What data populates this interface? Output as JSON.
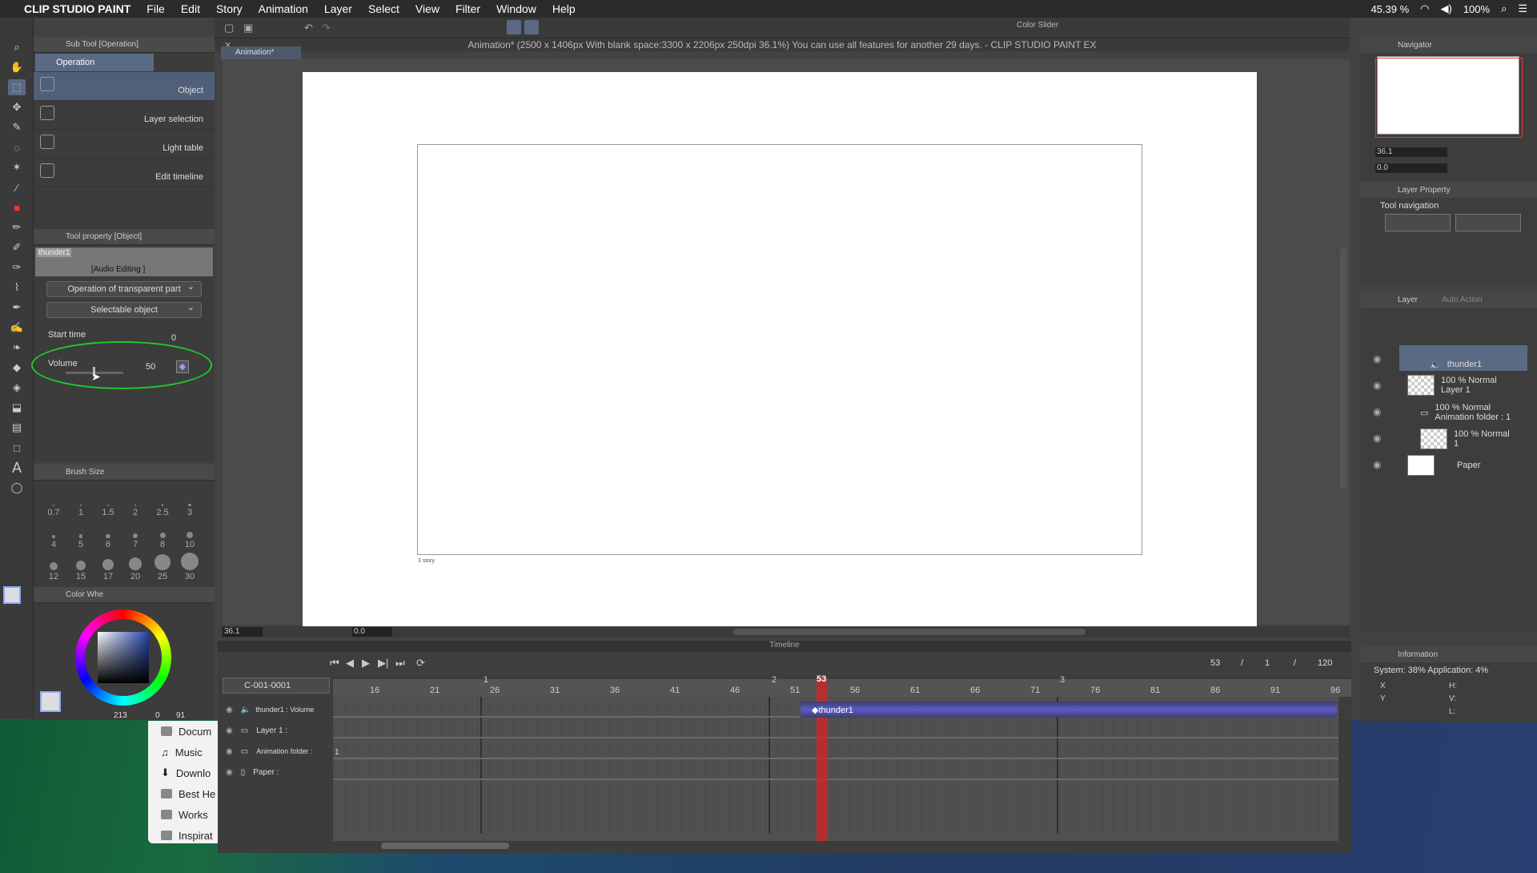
{
  "menubar": {
    "apple_icon": "apple-icon",
    "app": "CLIP STUDIO PAINT",
    "items": [
      "File",
      "Edit",
      "Story",
      "Animation",
      "Layer",
      "Select",
      "View",
      "Filter",
      "Window",
      "Help"
    ],
    "status": {
      "battery_pct": "45.39 %",
      "volume_pct": "100%"
    }
  },
  "toolbar": {
    "panel_label": "Color Slider"
  },
  "window": {
    "title": "Animation* (2500 x 1406px With blank space:3300 x 2206px 250dpi 36.1%)  You can use all features for another 29 days. - CLIP STUDIO PAINT EX",
    "tab": "Animation*"
  },
  "subtool": {
    "header": "Sub Tool [Operation]",
    "group": "Operation",
    "items": [
      "Object",
      "Layer selection",
      "Light table",
      "Edit timeline"
    ]
  },
  "toolprop": {
    "header": "Tool property [Object]",
    "clip_name": "thunder1",
    "clip_tag": "[Audio Editing ]",
    "dropdown1": "Operation of transparent part",
    "dropdown2": "Selectable object",
    "start_label": "Start time",
    "start_value": "0",
    "volume_label": "Volume",
    "volume_value": "50"
  },
  "brushsize": {
    "header": "Brush Size",
    "sizes": [
      "0.7",
      "1",
      "1.5",
      "2",
      "2.5",
      "3",
      "4",
      "5",
      "6",
      "7",
      "8",
      "10",
      "12",
      "15",
      "17",
      "20",
      "25",
      "30"
    ]
  },
  "color": {
    "header": "Color Whe",
    "readout": "213",
    "readout2": "0",
    "readout3": "91",
    "accent": "#2244aa"
  },
  "canvas": {
    "story_caption": "3 story",
    "zoom": "36.1",
    "rotate": "0.0"
  },
  "navigator": {
    "header": "Navigator",
    "zoom": "36.1",
    "rotate": "0.0"
  },
  "layerprop": {
    "header": "Layer Property",
    "tool_nav": "Tool navigation"
  },
  "layers": {
    "header": "Layer",
    "header2": "Auto Action",
    "items": [
      {
        "line1": "thunder1",
        "line2": ""
      },
      {
        "line1": "100 % Normal",
        "line2": "Layer 1"
      },
      {
        "line1": "100 % Normal",
        "line2": "Animation folder : 1"
      },
      {
        "line1": "100 % Normal",
        "line2": "1"
      },
      {
        "line1": "Paper",
        "line2": ""
      }
    ]
  },
  "info": {
    "header": "Information",
    "system": "System: 38% Application:  4%",
    "x": "X",
    "y": "Y",
    "h": "H:",
    "v": "V:",
    "l": "L:"
  },
  "timeline": {
    "header": "Timeline",
    "current_frame": "53",
    "sep1": "/",
    "frame_b": "1",
    "sep2": "/",
    "total": "120",
    "sheet": "C-001-0001",
    "ruler": [
      "16",
      "21",
      "26",
      "31",
      "36",
      "41",
      "46",
      "51",
      "56",
      "61",
      "66",
      "71",
      "76",
      "81",
      "86",
      "91",
      "96"
    ],
    "cuts": [
      "1",
      "2",
      "3"
    ],
    "playhead_label": "53",
    "tracks": [
      "thunder1 : Volume",
      "Layer 1 :",
      "Animation folder :",
      "Paper :"
    ],
    "clip_label": "thunder1",
    "folder_cell": "1"
  },
  "finder": {
    "items": [
      "Docum",
      "Music",
      "Downlo",
      "Best He",
      "Works",
      "Inspirat"
    ]
  }
}
